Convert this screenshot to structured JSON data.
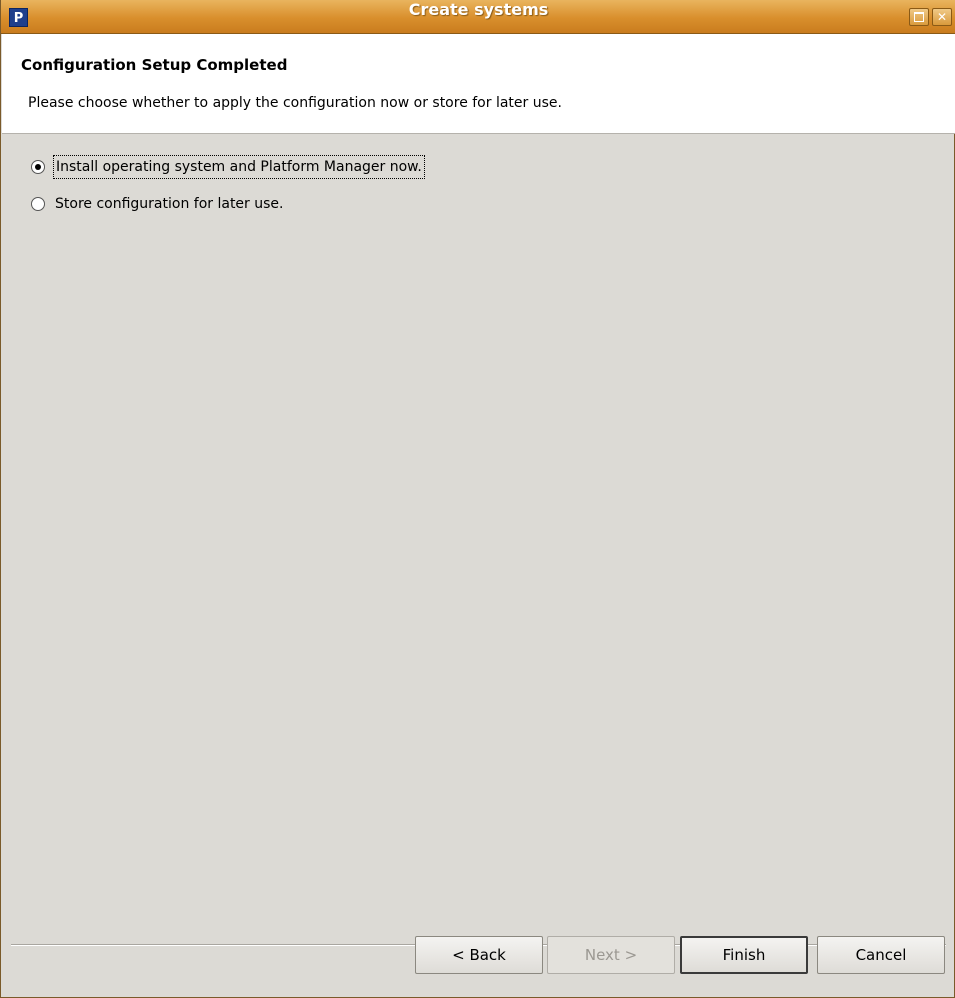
{
  "window": {
    "title": "Create systems",
    "app_icon_letter": "P"
  },
  "header": {
    "title": "Configuration Setup Completed",
    "description": "Please choose whether to apply the configuration now or store for later use."
  },
  "options": [
    {
      "label": "Install operating system and Platform Manager now.",
      "selected": true
    },
    {
      "label": "Store configuration for later use.",
      "selected": false
    }
  ],
  "buttons": {
    "back": "< Back",
    "next": "Next >",
    "finish": "Finish",
    "cancel": "Cancel"
  },
  "colors": {
    "titlebar": "#d98f2c",
    "dialog_bg": "#dcdad5",
    "header_bg": "#ffffff"
  }
}
